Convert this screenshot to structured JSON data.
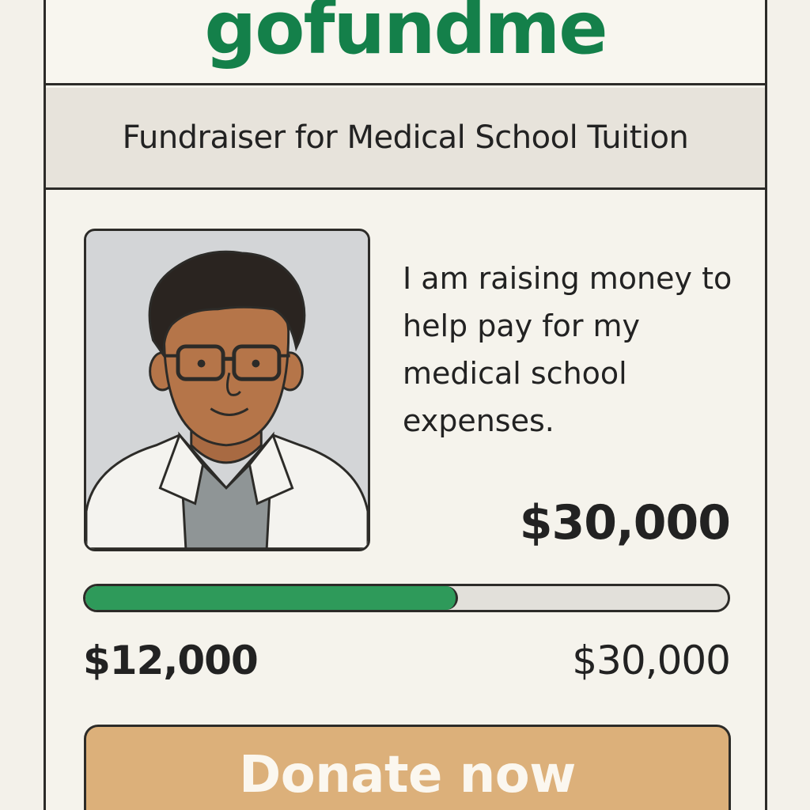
{
  "brand": {
    "logo_text": "gofundme",
    "color": "#14804a"
  },
  "campaign": {
    "title": "Fundraiser for Medical School Tuition",
    "description": "I am raising money to help pay for my medical school expenses.",
    "goal_display": "$30,000",
    "photo_icon": "doctor-portrait"
  },
  "progress": {
    "raised_label": "$12,000",
    "goal_label": "$30,000",
    "fraction": 0.58,
    "fill_color": "#2e9a5a",
    "track_color": "#e2e0da"
  },
  "actions": {
    "donate_label": "Donate now",
    "donate_color": "#dcb07a"
  }
}
